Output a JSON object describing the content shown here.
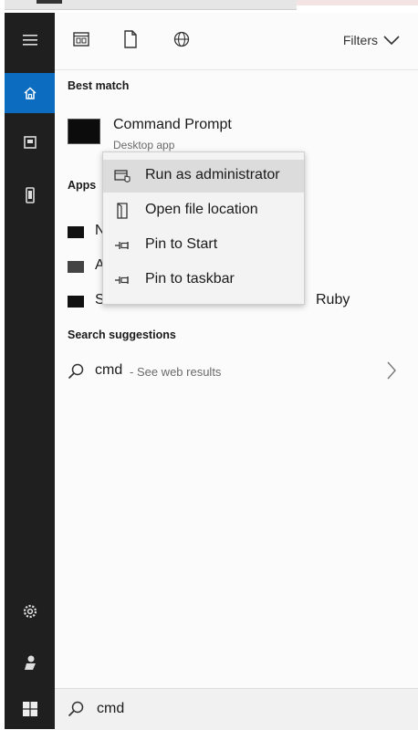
{
  "toolbar": {
    "icons": [
      "apps-icon",
      "documents-icon",
      "web-icon"
    ],
    "filters_label": "Filters"
  },
  "sidebar": {
    "items": [
      "menu-icon",
      "home-icon",
      "documents-icon",
      "device-icon",
      "settings-icon",
      "user-icon",
      "windows-start-icon"
    ],
    "active": "home-icon"
  },
  "best_match": {
    "section_label": "Best match",
    "name": "Command Prompt",
    "subtitle": "Desktop app"
  },
  "apps": {
    "section_label": "Apps",
    "items": [
      {
        "text": "N"
      },
      {
        "text": "A"
      },
      {
        "text": "S",
        "suffix": "Ruby"
      }
    ]
  },
  "context_menu": {
    "items": [
      {
        "label": "Run as administrator",
        "icon": "run-as-admin-icon",
        "highlighted": true
      },
      {
        "label": "Open file location",
        "icon": "open-file-location-icon",
        "highlighted": false
      },
      {
        "label": "Pin to Start",
        "icon": "pin-icon",
        "highlighted": false
      },
      {
        "label": "Pin to taskbar",
        "icon": "pin-icon",
        "highlighted": false
      }
    ]
  },
  "suggestions": {
    "section_label": "Search suggestions",
    "query": "cmd",
    "hint": "- See web results"
  },
  "search": {
    "value": "cmd"
  },
  "colors": {
    "sidebar_bg": "#1f1f1f",
    "accent": "#0b6cc0",
    "panel_bg": "#fbfbfb",
    "menu_bg": "#f3f3f3",
    "menu_hover": "#dcdcdc"
  }
}
